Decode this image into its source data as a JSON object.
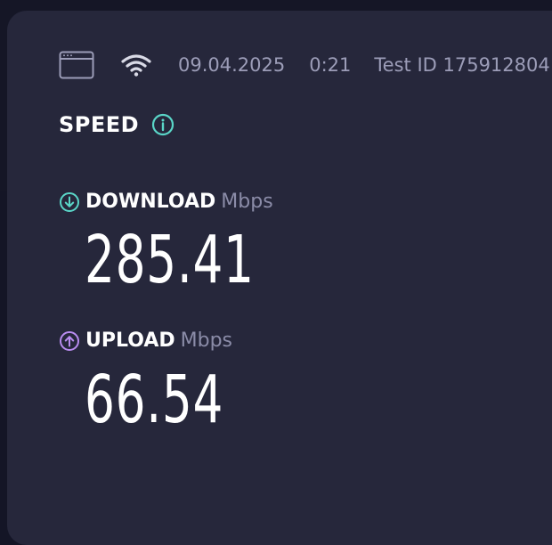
{
  "meta": {
    "date": "09.04.2025",
    "time": "0:21",
    "test_id": "Test ID 175912804",
    "icons": [
      "browser-window-icon",
      "wifi-icon"
    ]
  },
  "section": {
    "title": "SPEED",
    "info_icon": "info-icon"
  },
  "download": {
    "label": "DOWNLOAD",
    "unit": "Mbps",
    "value": "285.41",
    "icon": "arrow-down-circle-icon",
    "color": "#5ad6c8"
  },
  "upload": {
    "label": "UPLOAD",
    "unit": "Mbps",
    "value": "66.54",
    "icon": "arrow-up-circle-icon",
    "color": "#b98cf0"
  },
  "colors": {
    "background": "#141526",
    "card": "#26273b",
    "muted_text": "#9c9db8",
    "accent_teal": "#5ad6c8"
  }
}
